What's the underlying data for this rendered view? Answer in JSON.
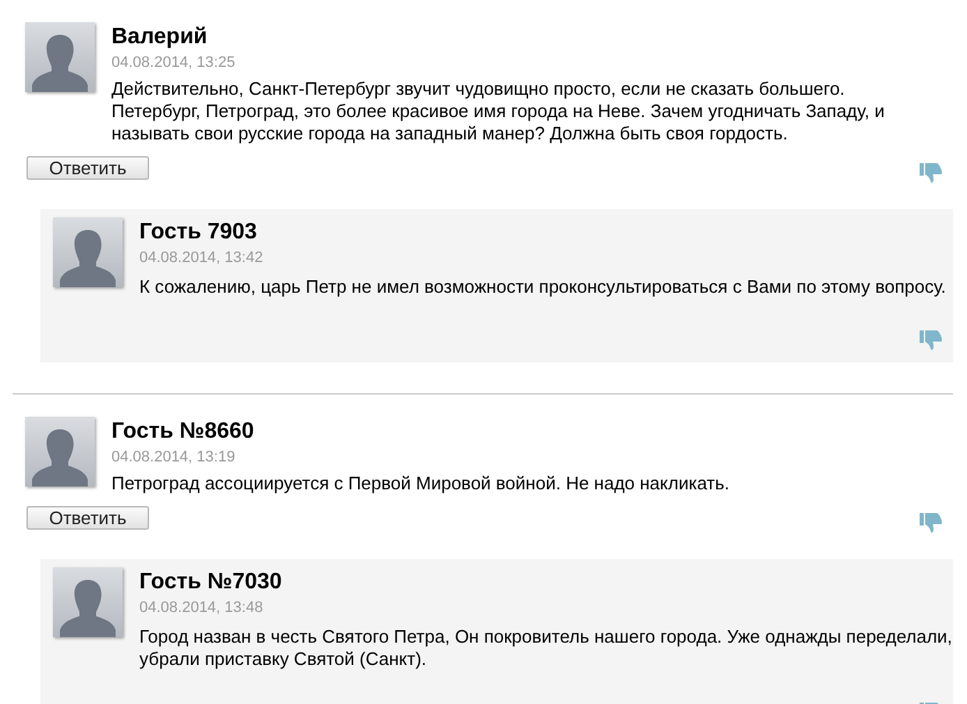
{
  "threads": [
    {
      "comment": {
        "name": "Валерий",
        "date": "04.08.2014, 13:25",
        "text": "Действительно, Санкт-Петербург звучит чудовищно просто, если не сказать большего. Петербург, Петроград, это более красивое имя города на Неве. Зачем угодничать Западу, и называть свои русские города на западный манер? Должна быть своя гордость."
      },
      "reply_button": "Ответить",
      "replies": [
        {
          "name": "Гость 7903",
          "date": "04.08.2014, 13:42",
          "text": "К сожалению, царь Петр не имел возможности проконсультироваться с Вами по этому вопросу."
        }
      ]
    },
    {
      "comment": {
        "name": "Гость №8660",
        "date": "04.08.2014, 13:19",
        "text": "Петроград ассоциируется с Первой Мировой войной. Не надо накликать."
      },
      "reply_button": "Ответить",
      "replies": [
        {
          "name": "Гость №7030",
          "date": "04.08.2014, 13:48",
          "text": "Город назван в честь Святого Петра, Он покровитель нашего города. Уже однажды переделали, убрали приставку Святой (Санкт)."
        }
      ]
    }
  ]
}
